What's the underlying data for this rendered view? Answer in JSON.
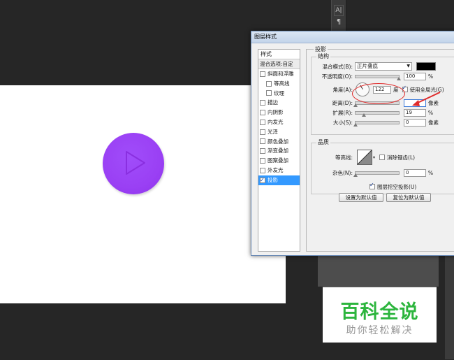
{
  "toolbar": {
    "icons": [
      "type-tool-icon",
      "paragraph-icon"
    ],
    "type_glyph": "A|",
    "para_glyph": "¶"
  },
  "dialog": {
    "title": "图层样式",
    "styles_header": "样式",
    "blend_options": "混合选项:自定",
    "style_items": [
      {
        "label": "斜面和浮雕",
        "checked": false,
        "indent": false
      },
      {
        "label": "等高线",
        "checked": false,
        "indent": true
      },
      {
        "label": "纹理",
        "checked": false,
        "indent": true
      },
      {
        "label": "描边",
        "checked": false,
        "indent": false
      },
      {
        "label": "内阴影",
        "checked": false,
        "indent": false
      },
      {
        "label": "内发光",
        "checked": false,
        "indent": false
      },
      {
        "label": "光泽",
        "checked": false,
        "indent": false
      },
      {
        "label": "颜色叠加",
        "checked": false,
        "indent": false
      },
      {
        "label": "渐变叠加",
        "checked": false,
        "indent": false
      },
      {
        "label": "图案叠加",
        "checked": false,
        "indent": false
      },
      {
        "label": "外发光",
        "checked": false,
        "indent": false
      },
      {
        "label": "投影",
        "checked": true,
        "indent": false,
        "selected": true
      }
    ],
    "drop_shadow": {
      "title": "投影",
      "structure_title": "结构",
      "blend_mode_label": "混合模式(B):",
      "blend_mode_value": "正片叠底",
      "shadow_color": "#000000",
      "opacity_label": "不透明度(O):",
      "opacity_value": "100",
      "opacity_unit": "%",
      "opacity_level": 1.0,
      "angle_label": "角度(A):",
      "angle_value": "122",
      "angle_unit": "度",
      "global_light_label": "使用全局光(G)",
      "global_light_checked": true,
      "distance_label": "距离(D):",
      "distance_value": "",
      "distance_unit": "像素",
      "spread_label": "扩展(R):",
      "spread_value": "19",
      "spread_unit": "%",
      "spread_level": 0.19,
      "size_label": "大小(S):",
      "size_value": "0",
      "size_unit": "像素",
      "quality_title": "品质",
      "contour_label": "等高线:",
      "anti_alias_label": "消除锯齿(L)",
      "anti_alias_checked": false,
      "noise_label": "杂色(N):",
      "noise_value": "0",
      "noise_unit": "%",
      "knockout_label": "图层挖空投影(U)",
      "knockout_checked": true,
      "make_default_label": "设置为默认值",
      "reset_default_label": "复位为默认值"
    }
  },
  "watermark": {
    "title": "百科全说",
    "subtitle": "助你轻松解决"
  },
  "colors": {
    "accent_purple": "#9b42f5",
    "annotation_red": "#e02b2b",
    "watermark_green": "#2cb53d",
    "selection_blue": "#3399ff"
  }
}
